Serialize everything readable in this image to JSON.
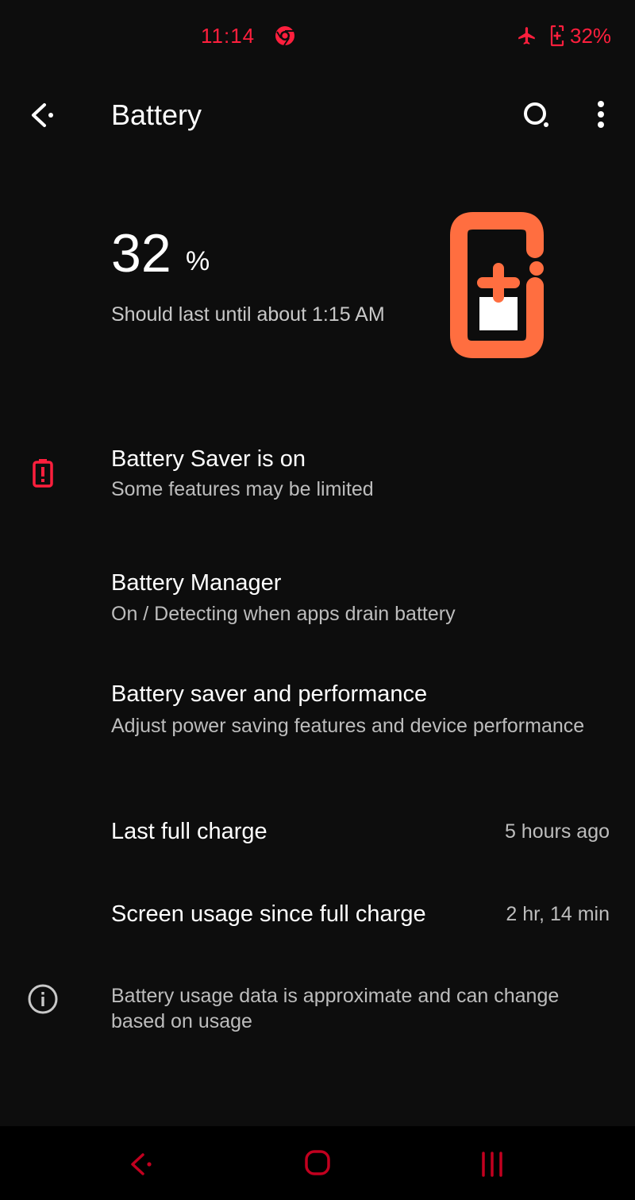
{
  "status_bar": {
    "time": "11:14",
    "battery_percent": "32%",
    "icons": [
      "chrome-icon",
      "airplane-mode-icon",
      "battery-saver-status-icon"
    ],
    "accent_color": "#ff1f3d"
  },
  "app_bar": {
    "title": "Battery",
    "icons": [
      "back-arrow-icon",
      "search-icon",
      "more-vert-icon"
    ]
  },
  "hero": {
    "level": "32",
    "percent_sign": "%",
    "estimate": "Should last until about 1:15 AM",
    "icon": "battery-saver-illustration-icon",
    "icon_color": "#ff6e40"
  },
  "items": {
    "saver": {
      "title": "Battery Saver is on",
      "summary": "Some features may be limited",
      "icon": "battery-alert-icon"
    },
    "manager": {
      "title": "Battery Manager",
      "summary": "On / Detecting when apps drain battery"
    },
    "performance": {
      "title": "Battery saver and performance",
      "summary": "Adjust power saving features and device performance"
    },
    "last_charge": {
      "title": "Last full charge",
      "value": "5 hours ago"
    },
    "screen_usage": {
      "title": "Screen usage since full charge",
      "value": "2 hr, 14 min"
    },
    "footer": {
      "text": "Battery usage data is approximate and can change based on usage",
      "icon": "info-icon"
    }
  },
  "nav_bar": {
    "icons": [
      "nav-back-icon",
      "nav-home-icon",
      "nav-recents-icon"
    ],
    "color": "#c2001f"
  }
}
